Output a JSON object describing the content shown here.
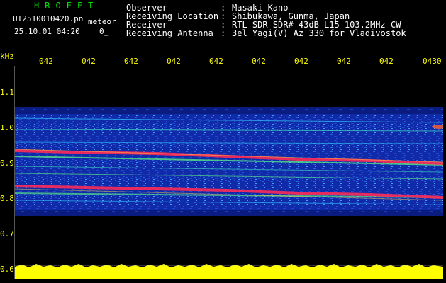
{
  "header": {
    "app_name": "HROFFT",
    "file_name": "UT2510010420.pn",
    "meteor_label": "meteor",
    "date_time": "25.10.01 04:20",
    "count": "0_"
  },
  "info": [
    {
      "label": "Observer",
      "sep": ":",
      "value": "Masaki Kano"
    },
    {
      "label": "Receiving Location",
      "sep": ":",
      "value": "Shibukawa, Gunma, Japan"
    },
    {
      "label": "Receiver",
      "sep": ":",
      "value": "RTL-SDR SDR# 43dB L15 103.2MHz CW"
    },
    {
      "label": "Receiving Antenna",
      "sep": ":",
      "value": "3el Yagi(V) Az 330 for Vladivostok"
    }
  ],
  "axis": {
    "y_unit": "kHz",
    "x_ticks": [
      "042",
      "042",
      "042",
      "042",
      "042",
      "042",
      "042",
      "042",
      "042",
      "0430"
    ],
    "y_ticks": [
      "1.1",
      "1.0",
      "0.9",
      "0.8",
      "0.7",
      "0.6"
    ]
  },
  "colors": {
    "background": "#000000",
    "accent_green": "#00e000",
    "label_yellow": "#ffff00",
    "signal_red": "#ff2a55",
    "noise_blue": "#1030c0"
  }
}
